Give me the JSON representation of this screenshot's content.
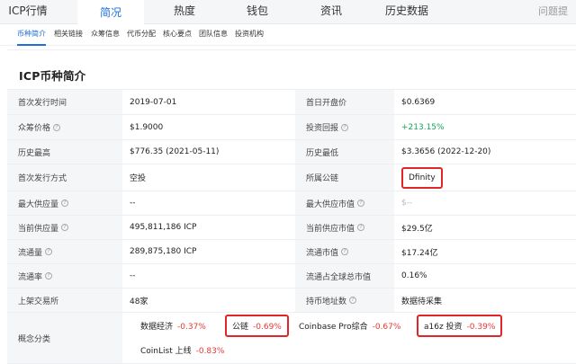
{
  "top_tabs": [
    {
      "label": "ICP行情",
      "active": false
    },
    {
      "label": "简况",
      "active": true
    },
    {
      "label": "热度",
      "active": false
    },
    {
      "label": "钱包",
      "active": false
    },
    {
      "label": "资讯",
      "active": false
    },
    {
      "label": "历史数据",
      "active": false
    }
  ],
  "feedback": "问题提交",
  "sub_tabs": [
    {
      "label": "币种简介",
      "active": true
    },
    {
      "label": "相关链接",
      "active": false
    },
    {
      "label": "众筹信息",
      "active": false
    },
    {
      "label": "代币分配",
      "active": false
    },
    {
      "label": "核心要点",
      "active": false
    },
    {
      "label": "团队信息",
      "active": false
    },
    {
      "label": "投资机构",
      "active": false
    }
  ],
  "section_title": "ICP币种简介",
  "rows": [
    {
      "l1": "首次发行时间",
      "v1": "2019-07-01",
      "l2": "首日开盘价",
      "v2": "$0.6369"
    },
    {
      "l1": "众筹价格",
      "v1": "$1.9000",
      "l2": "投资回报",
      "v2": "+213.15%"
    },
    {
      "l1": "历史最高",
      "v1": "$776.35 (2021-05-11)",
      "l2": "历史最低",
      "v2": "$3.3656 (2022-12-20)"
    },
    {
      "l1": "首次发行方式",
      "v1": "空投",
      "l2": "所属公链",
      "v2": "Dfinity"
    },
    {
      "l1": "最大供应量",
      "v1": "--",
      "l2": "最大供应市值",
      "v2": "$--"
    },
    {
      "l1": "当前供应量",
      "v1": "495,811,186 ICP",
      "l2": "当前供应市值",
      "v2": "$29.5亿"
    },
    {
      "l1": "流通量",
      "v1": "289,875,180 ICP",
      "l2": "流通市值",
      "v2": "$17.24亿"
    },
    {
      "l1": "流通率",
      "v1": "--",
      "l2": "流通占全球总市值",
      "v2": "0.16%"
    },
    {
      "l1": "上架交易所",
      "v1": "48家",
      "l2": "持币地址数",
      "v2": "数据待采集"
    }
  ],
  "concept_label": "概念分类",
  "concepts": [
    {
      "name": "数据经济",
      "pct": "-0.37%"
    },
    {
      "name": "公链",
      "pct": "-0.69%"
    },
    {
      "name": "Coinbase Pro综合",
      "pct": "-0.67%"
    },
    {
      "name": "a16z 投资",
      "pct": "-0.39%"
    },
    {
      "name": "CoinList 上线",
      "pct": "-0.83%"
    }
  ],
  "help_icon": "question-circle-icon",
  "colors": {
    "accent": "#1e6fd9",
    "positive": "#15a35a",
    "negative": "#e53935",
    "highlight_box": "#e0262a"
  }
}
